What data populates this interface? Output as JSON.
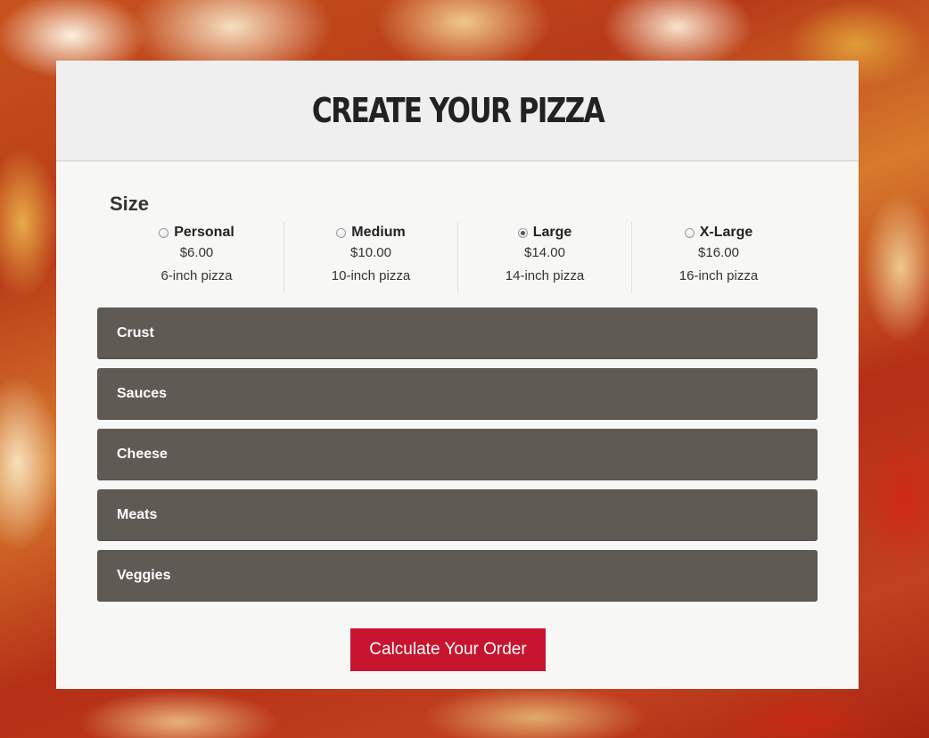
{
  "page": {
    "title": "CREATE YOUR PIZZA"
  },
  "size": {
    "label": "Size",
    "options": [
      {
        "name": "Personal",
        "price": "$6.00",
        "desc": "6-inch pizza",
        "selected": false
      },
      {
        "name": "Medium",
        "price": "$10.00",
        "desc": "10-inch pizza",
        "selected": false
      },
      {
        "name": "Large",
        "price": "$14.00",
        "desc": "14-inch pizza",
        "selected": true
      },
      {
        "name": "X-Large",
        "price": "$16.00",
        "desc": "16-inch pizza",
        "selected": false
      }
    ]
  },
  "sections": [
    {
      "label": "Crust"
    },
    {
      "label": "Sauces"
    },
    {
      "label": "Cheese"
    },
    {
      "label": "Meats"
    },
    {
      "label": "Veggies"
    }
  ],
  "actions": {
    "calculate_label": "Calculate Your Order"
  },
  "colors": {
    "accordion_bg": "#605a55",
    "button_bg": "#c8142e"
  }
}
